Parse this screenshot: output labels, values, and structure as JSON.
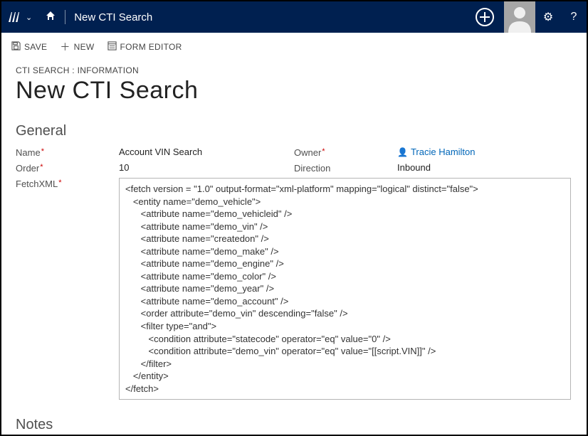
{
  "topbar": {
    "title": "New CTI Search"
  },
  "commands": {
    "save": "SAVE",
    "new": "NEW",
    "formEditor": "FORM EDITOR"
  },
  "header": {
    "breadcrumb": "CTI SEARCH : INFORMATION",
    "title": "New CTI Search"
  },
  "sections": {
    "general": "General",
    "notes": "Notes"
  },
  "fields": {
    "nameLabel": "Name",
    "nameValue": "Account VIN Search",
    "orderLabel": "Order",
    "orderValue": "10",
    "fetchLabel": "FetchXML",
    "ownerLabel": "Owner",
    "ownerValue": "Tracie Hamilton",
    "directionLabel": "Direction",
    "directionValue": "Inbound"
  },
  "fetchXml": "<fetch version = \"1.0\" output-format=\"xml-platform\" mapping=\"logical\" distinct=\"false\">\n   <entity name=\"demo_vehicle\">\n      <attribute name=\"demo_vehicleid\" />\n      <attribute name=\"demo_vin\" />\n      <attribute name=\"createdon\" />\n      <attribute name=\"demo_make\" />\n      <attribute name=\"demo_engine\" />\n      <attribute name=\"demo_color\" />\n      <attribute name=\"demo_year\" />\n      <attribute name=\"demo_account\" />\n      <order attribute=\"demo_vin\" descending=\"false\" />\n      <filter type=\"and\">\n         <condition attribute=\"statecode\" operator=\"eq\" value=\"0\" />\n         <condition attribute=\"demo_vin\" operator=\"eq\" value=\"[[script.VIN]]\" />\n      </filter>\n   </entity>\n</fetch>"
}
